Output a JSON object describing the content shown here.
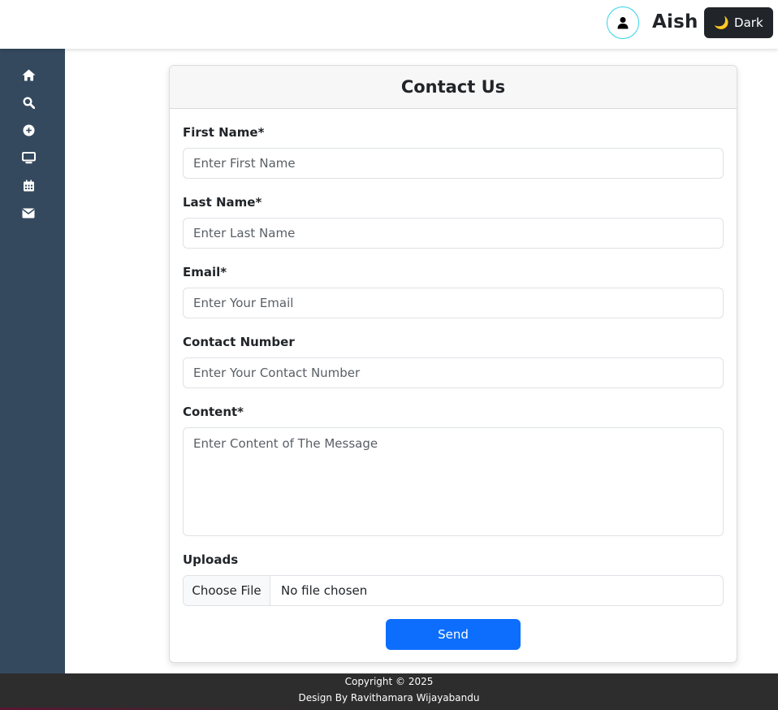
{
  "header": {
    "username": "Aish",
    "theme_toggle_label": "Dark"
  },
  "sidebar": {
    "items": [
      {
        "icon": "home-icon"
      },
      {
        "icon": "search-icon"
      },
      {
        "icon": "plus-circle-icon"
      },
      {
        "icon": "monitor-icon"
      },
      {
        "icon": "calendar-icon"
      },
      {
        "icon": "envelope-icon"
      }
    ]
  },
  "form": {
    "title": "Contact Us",
    "first_name": {
      "label": "First Name*",
      "placeholder": "Enter First Name",
      "value": ""
    },
    "last_name": {
      "label": "Last Name*",
      "placeholder": "Enter Last Name",
      "value": ""
    },
    "email": {
      "label": "Email*",
      "placeholder": "Enter Your Email",
      "value": ""
    },
    "contact_number": {
      "label": "Contact Number",
      "placeholder": "Enter Your Contact Number",
      "value": ""
    },
    "content": {
      "label": "Content*",
      "placeholder": "Enter Content of The Message",
      "value": ""
    },
    "uploads": {
      "label": "Uploads",
      "button_label": "Choose File",
      "status": "No file chosen"
    },
    "submit_label": "Send"
  },
  "footer": {
    "copyright": "Copyright © 2025",
    "credit": "Design By Ravithamara Wijayabandu"
  },
  "colors": {
    "sidebar_bg": "#34495e",
    "primary": "#0d6efd",
    "dark_button": "#212529",
    "footer_bg": "#2d2d2d",
    "avatar_ring": "#2fd4e6"
  }
}
